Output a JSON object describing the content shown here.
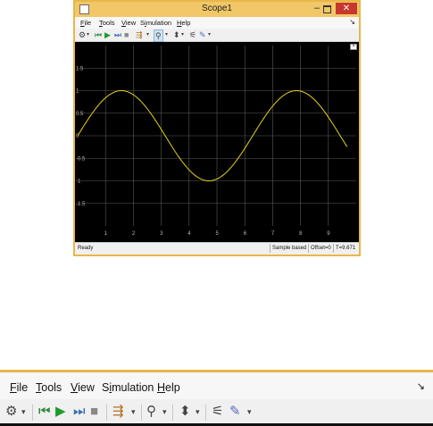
{
  "window": {
    "title": "Scope1",
    "controls": {
      "minimize": "–",
      "close": "✕"
    }
  },
  "menu": {
    "items": [
      {
        "label": "File"
      },
      {
        "label": "Tools"
      },
      {
        "label": "View"
      },
      {
        "label": "Simulation"
      },
      {
        "label": "Help"
      }
    ]
  },
  "toolbar": {
    "icons": [
      "parameters-icon",
      "step-back-icon",
      "run-icon",
      "step-forward-icon",
      "stop-icon",
      "highlight-icon",
      "zoom-in-icon",
      "autoscale-icon",
      "trigger-icon",
      "style-icon"
    ]
  },
  "chart_data": {
    "type": "line",
    "title": "",
    "xlabel": "",
    "ylabel": "",
    "xlim": [
      0,
      10
    ],
    "ylim": [
      -2,
      2
    ],
    "xticks": [
      1,
      2,
      3,
      4,
      5,
      6,
      7,
      8,
      9
    ],
    "yticks": [
      1.5,
      1,
      0.5,
      0,
      -0.5,
      -1,
      -1.5
    ],
    "ytick_labels": [
      "1.5",
      "1",
      "0.5",
      "0",
      "-0.5",
      "-1",
      "-1.5"
    ],
    "xtick_labels": [
      "1",
      "2",
      "3",
      "4",
      "5",
      "6",
      "7",
      "8",
      "9"
    ],
    "grid": true,
    "background": "#000000",
    "series": [
      {
        "color": "#e5d21a",
        "function": "sin",
        "x_end": 9.671
      }
    ]
  },
  "status": {
    "state": "Ready",
    "mode": "Sample based",
    "offset": "Offset=0",
    "time": "T=9.671"
  }
}
